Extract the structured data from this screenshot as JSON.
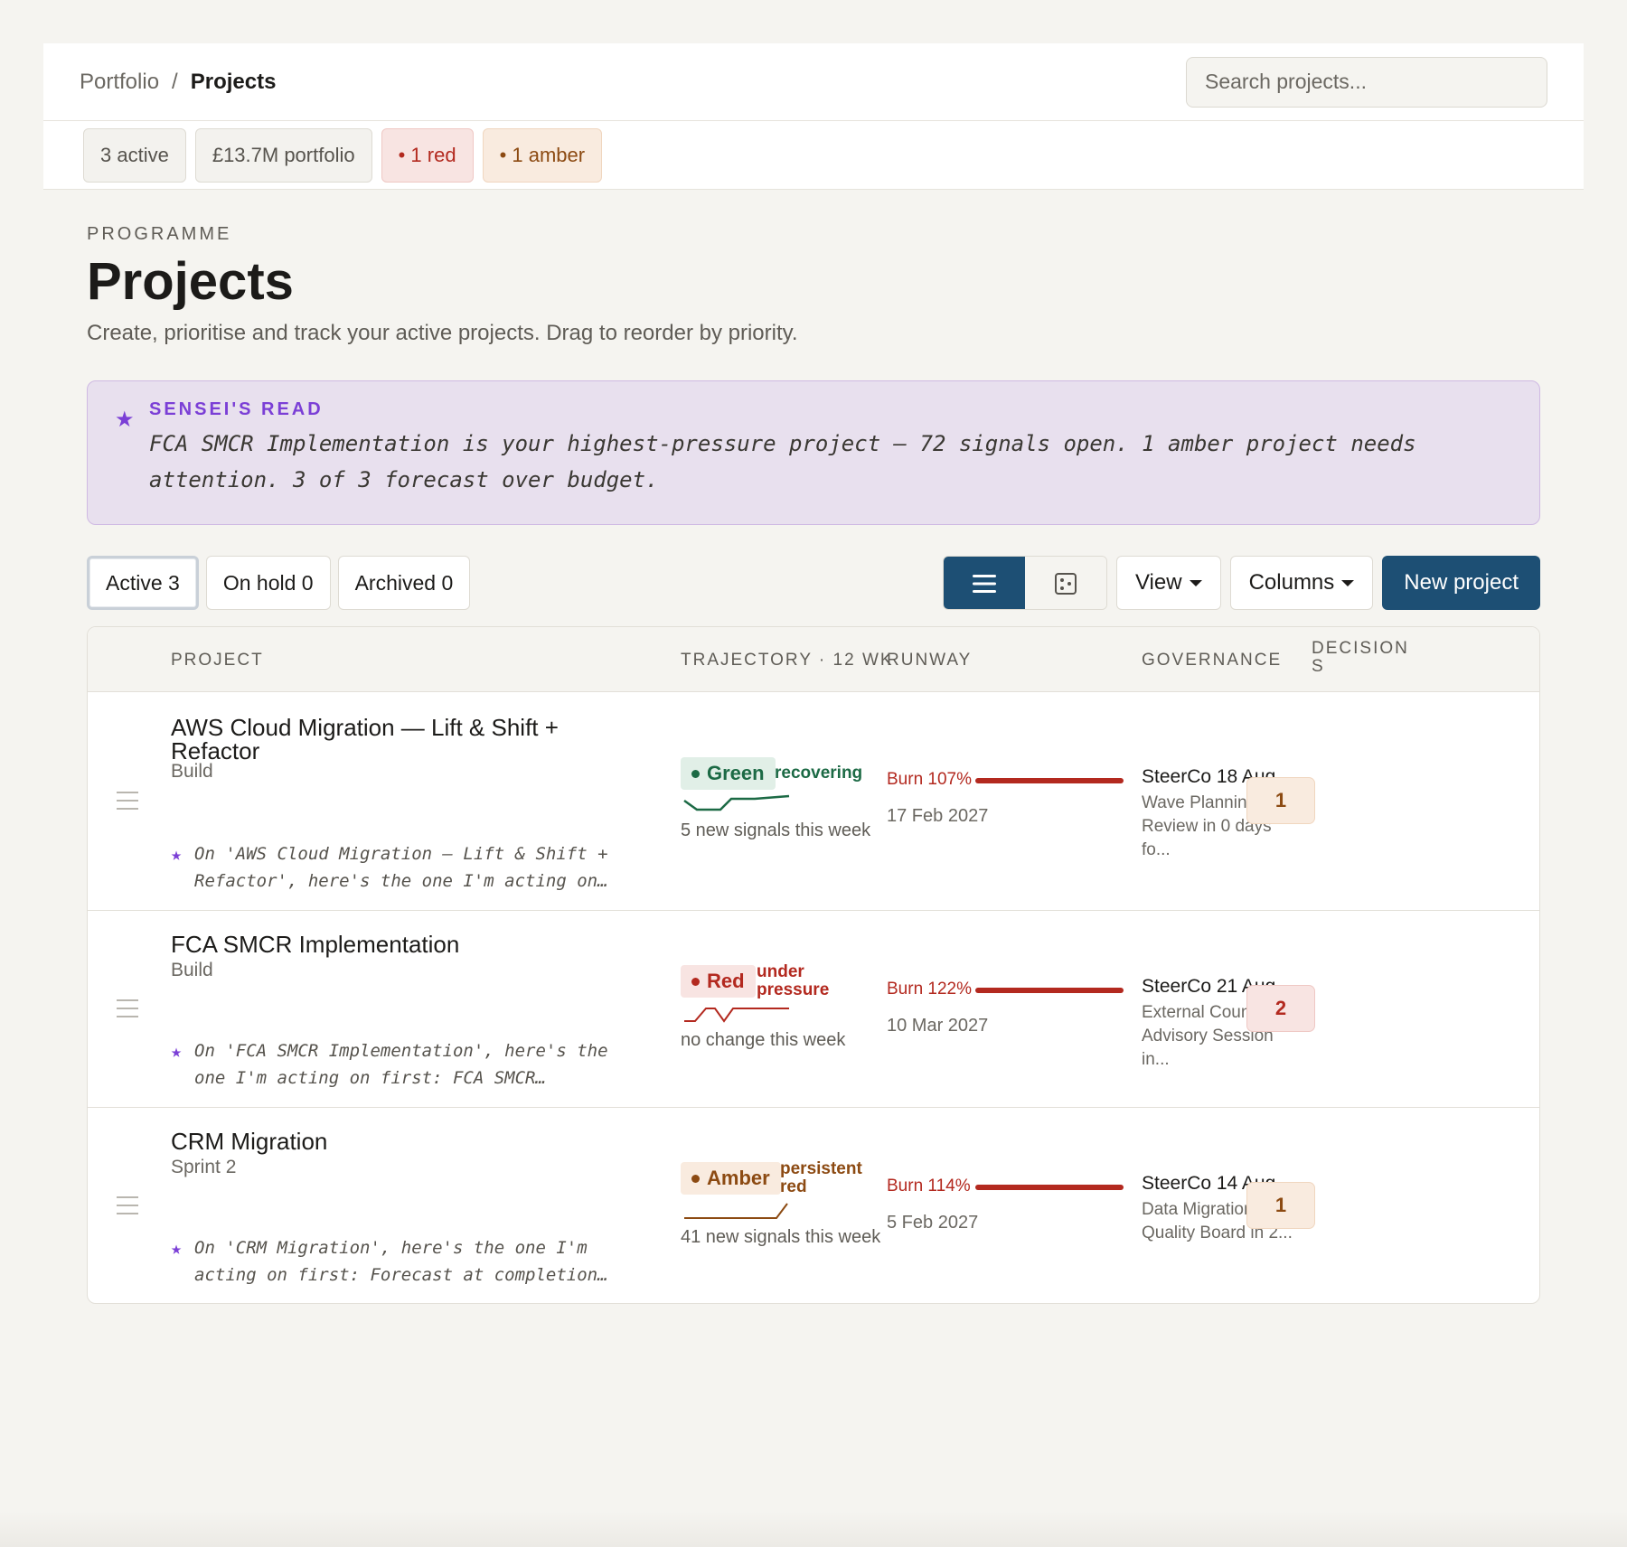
{
  "breadcrumb": {
    "root": "Portfolio",
    "separator": "/",
    "current": "Projects"
  },
  "search": {
    "placeholder": "Search projects..."
  },
  "stats": {
    "active": "3 active",
    "portfolio": "£13.7M portfolio",
    "red": "• 1 red",
    "amber": "• 1 amber"
  },
  "header": {
    "eyebrow": "PROGRAMME",
    "title": "Projects",
    "subtitle": "Create, prioritise and track your active projects. Drag to reorder by priority."
  },
  "sensei": {
    "star": "★",
    "label": "SENSEI'S READ",
    "text": "FCA SMCR Implementation is your highest-pressure project — 72 signals open. 1 amber project needs attention. 3 of 3 forecast over budget."
  },
  "tabs": [
    {
      "label": "Active 3",
      "active": true
    },
    {
      "label": "On hold 0",
      "active": false
    },
    {
      "label": "Archived 0",
      "active": false
    }
  ],
  "toolbar": {
    "view_toggle": [
      "list-icon",
      "grid-icon"
    ],
    "view_label": "View",
    "columns_label": "Columns",
    "new_project_label": "New project"
  },
  "columns": {
    "project": "PROJECT",
    "trajectory": "TRAJECTORY · 12 WK",
    "runway": "RUNWAY",
    "governance": "GOVERNANCE",
    "decisions": "DECISIONS"
  },
  "colors": {
    "primary": "#1d4f74",
    "green": "#1c6a45",
    "red": "#b3291f",
    "amber": "#8c4a12",
    "sensei": "#7b3fd6"
  },
  "projects": [
    {
      "name": "AWS Cloud Migration — Lift & Shift + Refactor",
      "stage": "Build",
      "note": "On 'AWS Cloud Migration — Lift & Shift + Refactor', here's the one I'm acting on…",
      "rag": "Green",
      "trend": "recovering",
      "signals": "5 new signals this week",
      "burn": "Burn 107%",
      "runway_date": "17 Feb 2027",
      "governance": "SteerCo 18 Aug",
      "governance_detail": "Wave Planning & Review in 0 days fo...",
      "decisions": "1"
    },
    {
      "name": "FCA SMCR Implementation",
      "stage": "Build",
      "note": "On 'FCA SMCR Implementation', here's the one I'm acting on first: FCA SMCR…",
      "rag": "Red",
      "trend": "under pressure",
      "signals": "no change this week",
      "burn": "Burn 122%",
      "runway_date": "10 Mar 2027",
      "governance": "SteerCo 21 Aug",
      "governance_detail": "External Counsel Advisory Session in...",
      "decisions": "2"
    },
    {
      "name": "CRM Migration",
      "stage": "Sprint 2",
      "note": "On 'CRM Migration', here's the one I'm acting on first: Forecast at completion…",
      "rag": "Amber",
      "trend": "persistent red",
      "signals": "41 new signals this week",
      "burn": "Burn 114%",
      "runway_date": "5 Feb 2027",
      "governance": "SteerCo 14 Aug",
      "governance_detail": "Data Migration Quality Board in 2...",
      "decisions": "1"
    }
  ]
}
